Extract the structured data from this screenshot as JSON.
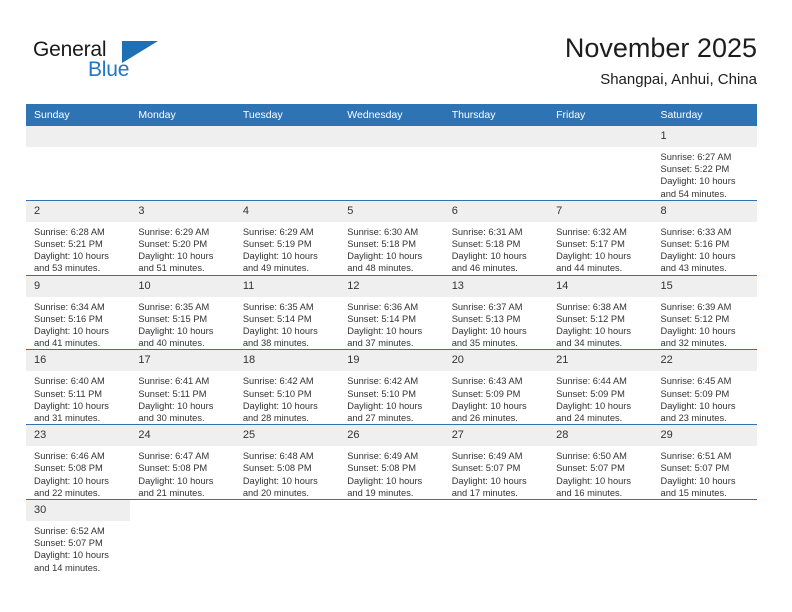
{
  "brand": {
    "name_top": "General",
    "name_bottom": "Blue",
    "accent_color": "#2176c7",
    "triangle_color": "#1f6fb5"
  },
  "header": {
    "title": "November 2025",
    "subtitle": "Shangpai, Anhui, China"
  },
  "theme": {
    "header_blue": "#2e74b5",
    "daynum_gray": "#efefef",
    "text_color": "#333333"
  },
  "weekdays": [
    "Sunday",
    "Monday",
    "Tuesday",
    "Wednesday",
    "Thursday",
    "Friday",
    "Saturday"
  ],
  "weeks": [
    [
      {
        "day": "",
        "blank": true
      },
      {
        "day": "",
        "blank": true
      },
      {
        "day": "",
        "blank": true
      },
      {
        "day": "",
        "blank": true
      },
      {
        "day": "",
        "blank": true
      },
      {
        "day": "",
        "blank": true
      },
      {
        "day": "1",
        "sunrise": "Sunrise: 6:27 AM",
        "sunset": "Sunset: 5:22 PM",
        "daylight_1": "Daylight: 10 hours",
        "daylight_2": "and 54 minutes."
      }
    ],
    [
      {
        "day": "2",
        "sunrise": "Sunrise: 6:28 AM",
        "sunset": "Sunset: 5:21 PM",
        "daylight_1": "Daylight: 10 hours",
        "daylight_2": "and 53 minutes."
      },
      {
        "day": "3",
        "sunrise": "Sunrise: 6:29 AM",
        "sunset": "Sunset: 5:20 PM",
        "daylight_1": "Daylight: 10 hours",
        "daylight_2": "and 51 minutes."
      },
      {
        "day": "4",
        "sunrise": "Sunrise: 6:29 AM",
        "sunset": "Sunset: 5:19 PM",
        "daylight_1": "Daylight: 10 hours",
        "daylight_2": "and 49 minutes."
      },
      {
        "day": "5",
        "sunrise": "Sunrise: 6:30 AM",
        "sunset": "Sunset: 5:18 PM",
        "daylight_1": "Daylight: 10 hours",
        "daylight_2": "and 48 minutes."
      },
      {
        "day": "6",
        "sunrise": "Sunrise: 6:31 AM",
        "sunset": "Sunset: 5:18 PM",
        "daylight_1": "Daylight: 10 hours",
        "daylight_2": "and 46 minutes."
      },
      {
        "day": "7",
        "sunrise": "Sunrise: 6:32 AM",
        "sunset": "Sunset: 5:17 PM",
        "daylight_1": "Daylight: 10 hours",
        "daylight_2": "and 44 minutes."
      },
      {
        "day": "8",
        "sunrise": "Sunrise: 6:33 AM",
        "sunset": "Sunset: 5:16 PM",
        "daylight_1": "Daylight: 10 hours",
        "daylight_2": "and 43 minutes."
      }
    ],
    [
      {
        "day": "9",
        "sunrise": "Sunrise: 6:34 AM",
        "sunset": "Sunset: 5:16 PM",
        "daylight_1": "Daylight: 10 hours",
        "daylight_2": "and 41 minutes."
      },
      {
        "day": "10",
        "sunrise": "Sunrise: 6:35 AM",
        "sunset": "Sunset: 5:15 PM",
        "daylight_1": "Daylight: 10 hours",
        "daylight_2": "and 40 minutes."
      },
      {
        "day": "11",
        "sunrise": "Sunrise: 6:35 AM",
        "sunset": "Sunset: 5:14 PM",
        "daylight_1": "Daylight: 10 hours",
        "daylight_2": "and 38 minutes."
      },
      {
        "day": "12",
        "sunrise": "Sunrise: 6:36 AM",
        "sunset": "Sunset: 5:14 PM",
        "daylight_1": "Daylight: 10 hours",
        "daylight_2": "and 37 minutes."
      },
      {
        "day": "13",
        "sunrise": "Sunrise: 6:37 AM",
        "sunset": "Sunset: 5:13 PM",
        "daylight_1": "Daylight: 10 hours",
        "daylight_2": "and 35 minutes."
      },
      {
        "day": "14",
        "sunrise": "Sunrise: 6:38 AM",
        "sunset": "Sunset: 5:12 PM",
        "daylight_1": "Daylight: 10 hours",
        "daylight_2": "and 34 minutes."
      },
      {
        "day": "15",
        "sunrise": "Sunrise: 6:39 AM",
        "sunset": "Sunset: 5:12 PM",
        "daylight_1": "Daylight: 10 hours",
        "daylight_2": "and 32 minutes."
      }
    ],
    [
      {
        "day": "16",
        "sunrise": "Sunrise: 6:40 AM",
        "sunset": "Sunset: 5:11 PM",
        "daylight_1": "Daylight: 10 hours",
        "daylight_2": "and 31 minutes."
      },
      {
        "day": "17",
        "sunrise": "Sunrise: 6:41 AM",
        "sunset": "Sunset: 5:11 PM",
        "daylight_1": "Daylight: 10 hours",
        "daylight_2": "and 30 minutes."
      },
      {
        "day": "18",
        "sunrise": "Sunrise: 6:42 AM",
        "sunset": "Sunset: 5:10 PM",
        "daylight_1": "Daylight: 10 hours",
        "daylight_2": "and 28 minutes."
      },
      {
        "day": "19",
        "sunrise": "Sunrise: 6:42 AM",
        "sunset": "Sunset: 5:10 PM",
        "daylight_1": "Daylight: 10 hours",
        "daylight_2": "and 27 minutes."
      },
      {
        "day": "20",
        "sunrise": "Sunrise: 6:43 AM",
        "sunset": "Sunset: 5:09 PM",
        "daylight_1": "Daylight: 10 hours",
        "daylight_2": "and 26 minutes."
      },
      {
        "day": "21",
        "sunrise": "Sunrise: 6:44 AM",
        "sunset": "Sunset: 5:09 PM",
        "daylight_1": "Daylight: 10 hours",
        "daylight_2": "and 24 minutes."
      },
      {
        "day": "22",
        "sunrise": "Sunrise: 6:45 AM",
        "sunset": "Sunset: 5:09 PM",
        "daylight_1": "Daylight: 10 hours",
        "daylight_2": "and 23 minutes."
      }
    ],
    [
      {
        "day": "23",
        "sunrise": "Sunrise: 6:46 AM",
        "sunset": "Sunset: 5:08 PM",
        "daylight_1": "Daylight: 10 hours",
        "daylight_2": "and 22 minutes."
      },
      {
        "day": "24",
        "sunrise": "Sunrise: 6:47 AM",
        "sunset": "Sunset: 5:08 PM",
        "daylight_1": "Daylight: 10 hours",
        "daylight_2": "and 21 minutes."
      },
      {
        "day": "25",
        "sunrise": "Sunrise: 6:48 AM",
        "sunset": "Sunset: 5:08 PM",
        "daylight_1": "Daylight: 10 hours",
        "daylight_2": "and 20 minutes."
      },
      {
        "day": "26",
        "sunrise": "Sunrise: 6:49 AM",
        "sunset": "Sunset: 5:08 PM",
        "daylight_1": "Daylight: 10 hours",
        "daylight_2": "and 19 minutes."
      },
      {
        "day": "27",
        "sunrise": "Sunrise: 6:49 AM",
        "sunset": "Sunset: 5:07 PM",
        "daylight_1": "Daylight: 10 hours",
        "daylight_2": "and 17 minutes."
      },
      {
        "day": "28",
        "sunrise": "Sunrise: 6:50 AM",
        "sunset": "Sunset: 5:07 PM",
        "daylight_1": "Daylight: 10 hours",
        "daylight_2": "and 16 minutes."
      },
      {
        "day": "29",
        "sunrise": "Sunrise: 6:51 AM",
        "sunset": "Sunset: 5:07 PM",
        "daylight_1": "Daylight: 10 hours",
        "daylight_2": "and 15 minutes."
      }
    ],
    [
      {
        "day": "30",
        "sunrise": "Sunrise: 6:52 AM",
        "sunset": "Sunset: 5:07 PM",
        "daylight_1": "Daylight: 10 hours",
        "daylight_2": "and 14 minutes."
      },
      {
        "day": "",
        "empty": true
      },
      {
        "day": "",
        "empty": true
      },
      {
        "day": "",
        "empty": true
      },
      {
        "day": "",
        "empty": true
      },
      {
        "day": "",
        "empty": true
      },
      {
        "day": "",
        "empty": true
      }
    ]
  ]
}
